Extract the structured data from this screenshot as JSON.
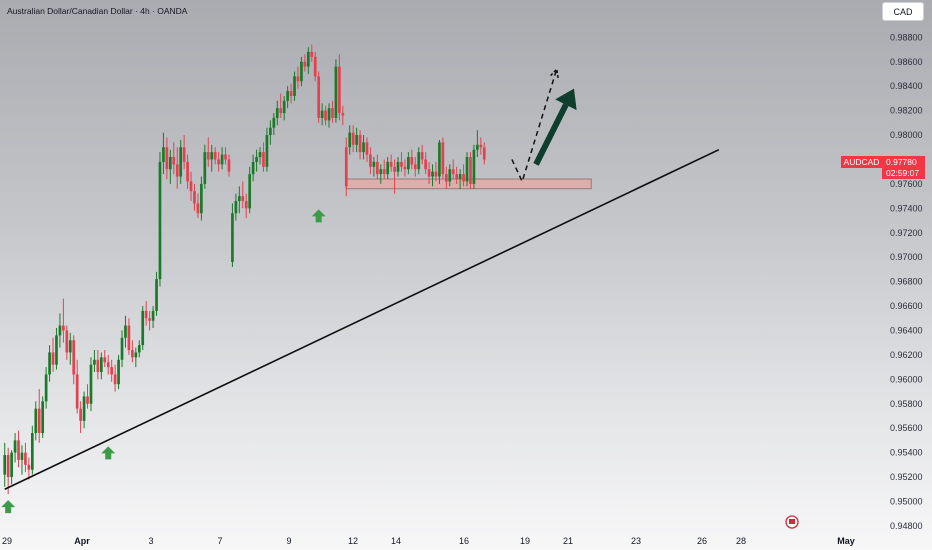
{
  "header": {
    "title": "Australian Dollar/Canadian Dollar · 4h · OANDA",
    "currency_button": "CAD"
  },
  "price_tag": {
    "symbol": "AUDCAD",
    "price": "0.97780",
    "countdown": "02:59:07",
    "color": "#f23645"
  },
  "colors": {
    "up": "#1b7a2a",
    "down": "#e2414f",
    "trendline": "#0d0d0d",
    "arrow": "#0f3d2e",
    "support_fill": "#e8a7a4",
    "signal_arrow": "#3d9a48"
  },
  "icons": [
    "flag-icon",
    "up-arrow-icon"
  ],
  "chart_data": {
    "type": "candlestick",
    "title": "Australian Dollar/Canadian Dollar · 4h · OANDA",
    "symbol": "AUDCAD",
    "ylim": [
      0.9475,
      0.9895
    ],
    "y_ticks": [
      "0.98800",
      "0.98600",
      "0.98400",
      "0.98200",
      "0.98000",
      "0.97800",
      "0.97600",
      "0.97400",
      "0.97200",
      "0.97000",
      "0.96800",
      "0.96600",
      "0.96400",
      "0.96200",
      "0.96000",
      "0.95800",
      "0.95600",
      "0.95400",
      "0.95200",
      "0.95000",
      "0.94800"
    ],
    "x_ticks": [
      {
        "label": "29",
        "bold": false
      },
      {
        "label": "Apr",
        "bold": true
      },
      {
        "label": "3",
        "bold": false
      },
      {
        "label": "7",
        "bold": false
      },
      {
        "label": "9",
        "bold": false
      },
      {
        "label": "12",
        "bold": false
      },
      {
        "label": "14",
        "bold": false
      },
      {
        "label": "16",
        "bold": false
      },
      {
        "label": "19",
        "bold": false
      },
      {
        "label": "21",
        "bold": false
      },
      {
        "label": "23",
        "bold": false
      },
      {
        "label": "26",
        "bold": false
      },
      {
        "label": "28",
        "bold": false
      },
      {
        "label": "May",
        "bold": true
      }
    ],
    "candles": [
      [
        0.9522,
        0.9548,
        0.9512,
        0.9538
      ],
      [
        0.9538,
        0.9544,
        0.9506,
        0.952
      ],
      [
        0.952,
        0.9542,
        0.9514,
        0.954
      ],
      [
        0.954,
        0.9556,
        0.9532,
        0.955
      ],
      [
        0.955,
        0.9558,
        0.9528,
        0.9534
      ],
      [
        0.9534,
        0.9546,
        0.9522,
        0.954
      ],
      [
        0.954,
        0.9548,
        0.9524,
        0.953
      ],
      [
        0.953,
        0.9536,
        0.9518,
        0.9526
      ],
      [
        0.9526,
        0.9562,
        0.9522,
        0.9556
      ],
      [
        0.9556,
        0.9582,
        0.955,
        0.9576
      ],
      [
        0.9576,
        0.9592,
        0.9548,
        0.9556
      ],
      [
        0.9556,
        0.9586,
        0.9552,
        0.9582
      ],
      [
        0.9582,
        0.961,
        0.9576,
        0.9604
      ],
      [
        0.9604,
        0.9628,
        0.9598,
        0.9622
      ],
      [
        0.9622,
        0.9634,
        0.9606,
        0.9612
      ],
      [
        0.9612,
        0.9642,
        0.9608,
        0.9636
      ],
      [
        0.9636,
        0.9654,
        0.9626,
        0.9644
      ],
      [
        0.9644,
        0.9666,
        0.963,
        0.964
      ],
      [
        0.964,
        0.9644,
        0.9616,
        0.9622
      ],
      [
        0.9622,
        0.9638,
        0.9612,
        0.9632
      ],
      [
        0.9632,
        0.9636,
        0.9596,
        0.9604
      ],
      [
        0.9604,
        0.9616,
        0.9572,
        0.9576
      ],
      [
        0.9576,
        0.9582,
        0.9556,
        0.9566
      ],
      [
        0.9566,
        0.959,
        0.956,
        0.9586
      ],
      [
        0.9586,
        0.9596,
        0.9576,
        0.958
      ],
      [
        0.958,
        0.9618,
        0.9574,
        0.9612
      ],
      [
        0.9612,
        0.9624,
        0.9606,
        0.9616
      ],
      [
        0.9616,
        0.9624,
        0.96,
        0.9606
      ],
      [
        0.9606,
        0.9622,
        0.96,
        0.9618
      ],
      [
        0.9618,
        0.9624,
        0.961,
        0.9614
      ],
      [
        0.9614,
        0.962,
        0.9604,
        0.961
      ],
      [
        0.961,
        0.9616,
        0.9598,
        0.9604
      ],
      [
        0.9604,
        0.9612,
        0.959,
        0.9596
      ],
      [
        0.9596,
        0.962,
        0.9592,
        0.9616
      ],
      [
        0.9616,
        0.964,
        0.961,
        0.9634
      ],
      [
        0.9634,
        0.9652,
        0.9626,
        0.9644
      ],
      [
        0.9644,
        0.965,
        0.962,
        0.9624
      ],
      [
        0.9624,
        0.9632,
        0.9614,
        0.9618
      ],
      [
        0.9618,
        0.9626,
        0.961,
        0.9622
      ],
      [
        0.9622,
        0.9632,
        0.9618,
        0.9628
      ],
      [
        0.9628,
        0.966,
        0.9624,
        0.9656
      ],
      [
        0.9656,
        0.9664,
        0.9644,
        0.965
      ],
      [
        0.965,
        0.9656,
        0.964,
        0.9648
      ],
      [
        0.9648,
        0.966,
        0.9642,
        0.9656
      ],
      [
        0.9656,
        0.9688,
        0.9652,
        0.9682
      ],
      [
        0.9682,
        0.9786,
        0.9676,
        0.9778
      ],
      [
        0.9778,
        0.9802,
        0.9768,
        0.979
      ],
      [
        0.979,
        0.9798,
        0.9764,
        0.9772
      ],
      [
        0.9772,
        0.9788,
        0.976,
        0.9782
      ],
      [
        0.9782,
        0.9794,
        0.9768,
        0.9776
      ],
      [
        0.9776,
        0.979,
        0.9756,
        0.9766
      ],
      [
        0.9766,
        0.9796,
        0.976,
        0.979
      ],
      [
        0.979,
        0.98,
        0.9772,
        0.9778
      ],
      [
        0.9778,
        0.9784,
        0.9756,
        0.9762
      ],
      [
        0.9762,
        0.977,
        0.9746,
        0.9754
      ],
      [
        0.9754,
        0.976,
        0.9738,
        0.9744
      ],
      [
        0.9744,
        0.9752,
        0.9732,
        0.9736
      ],
      [
        0.9736,
        0.9766,
        0.973,
        0.976
      ],
      [
        0.976,
        0.9792,
        0.9756,
        0.9786
      ],
      [
        0.9786,
        0.9798,
        0.9774,
        0.978
      ],
      [
        0.978,
        0.9792,
        0.977,
        0.9786
      ],
      [
        0.9786,
        0.979,
        0.9776,
        0.978
      ],
      [
        0.978,
        0.9786,
        0.977,
        0.9776
      ],
      [
        0.9776,
        0.979,
        0.9772,
        0.9784
      ],
      [
        0.9784,
        0.979,
        0.9776,
        0.978
      ],
      [
        0.978,
        0.9784,
        0.9766,
        0.977
      ],
      [
        0.9696,
        0.9744,
        0.9692,
        0.9736
      ],
      [
        0.9736,
        0.9752,
        0.973,
        0.9746
      ],
      [
        0.9746,
        0.9758,
        0.9736,
        0.975
      ],
      [
        0.975,
        0.9762,
        0.974,
        0.9746
      ],
      [
        0.9746,
        0.9752,
        0.9732,
        0.974
      ],
      [
        0.974,
        0.9774,
        0.9736,
        0.9768
      ],
      [
        0.9768,
        0.9784,
        0.9762,
        0.9778
      ],
      [
        0.9778,
        0.9788,
        0.977,
        0.9782
      ],
      [
        0.9782,
        0.979,
        0.9776,
        0.9786
      ],
      [
        0.9786,
        0.9794,
        0.977,
        0.9774
      ],
      [
        0.9774,
        0.9806,
        0.977,
        0.98
      ],
      [
        0.98,
        0.9812,
        0.9792,
        0.9806
      ],
      [
        0.9806,
        0.9818,
        0.98,
        0.9814
      ],
      [
        0.9814,
        0.9828,
        0.9808,
        0.9822
      ],
      [
        0.9822,
        0.9834,
        0.9814,
        0.9818
      ],
      [
        0.9818,
        0.9832,
        0.9812,
        0.9828
      ],
      [
        0.9828,
        0.984,
        0.9822,
        0.9836
      ],
      [
        0.9836,
        0.9842,
        0.9826,
        0.9832
      ],
      [
        0.9832,
        0.9852,
        0.9828,
        0.9848
      ],
      [
        0.9848,
        0.9856,
        0.9838,
        0.9844
      ],
      [
        0.9844,
        0.9864,
        0.984,
        0.986
      ],
      [
        0.986,
        0.9866,
        0.9852,
        0.9856
      ],
      [
        0.9856,
        0.9872,
        0.985,
        0.9868
      ],
      [
        0.9868,
        0.9874,
        0.986,
        0.9864
      ],
      [
        0.9864,
        0.9868,
        0.9844,
        0.9848
      ],
      [
        0.9848,
        0.9852,
        0.981,
        0.9814
      ],
      [
        0.9814,
        0.9826,
        0.9808,
        0.982
      ],
      [
        0.982,
        0.9824,
        0.9808,
        0.9812
      ],
      [
        0.9812,
        0.9826,
        0.9806,
        0.9822
      ],
      [
        0.9822,
        0.9828,
        0.981,
        0.9814
      ],
      [
        0.9814,
        0.9862,
        0.981,
        0.9856
      ],
      [
        0.9856,
        0.9866,
        0.9812,
        0.9818
      ],
      [
        0.9818,
        0.9824,
        0.9808,
        0.9816
      ],
      [
        0.979,
        0.9798,
        0.975,
        0.9758
      ],
      [
        0.979,
        0.9808,
        0.9784,
        0.9802
      ],
      [
        0.9802,
        0.9808,
        0.9786,
        0.9792
      ],
      [
        0.9792,
        0.9806,
        0.9786,
        0.98
      ],
      [
        0.98,
        0.9804,
        0.978,
        0.9786
      ],
      [
        0.9786,
        0.98,
        0.978,
        0.9794
      ],
      [
        0.9794,
        0.9798,
        0.9778,
        0.9784
      ],
      [
        0.9784,
        0.979,
        0.9768,
        0.9774
      ],
      [
        0.9774,
        0.9782,
        0.9766,
        0.9778
      ],
      [
        0.9778,
        0.9784,
        0.9764,
        0.9768
      ],
      [
        0.9768,
        0.9776,
        0.976,
        0.9772
      ],
      [
        0.9772,
        0.978,
        0.9764,
        0.9768
      ],
      [
        0.9768,
        0.9782,
        0.9764,
        0.9778
      ],
      [
        0.9778,
        0.9784,
        0.977,
        0.9774
      ],
      [
        0.9774,
        0.978,
        0.9752,
        0.977
      ],
      [
        0.977,
        0.9782,
        0.9766,
        0.9778
      ],
      [
        0.9778,
        0.9786,
        0.977,
        0.9774
      ],
      [
        0.9774,
        0.978,
        0.9766,
        0.9772
      ],
      [
        0.9772,
        0.9786,
        0.9768,
        0.9782
      ],
      [
        0.9782,
        0.9788,
        0.9772,
        0.9776
      ],
      [
        0.9776,
        0.9782,
        0.9766,
        0.9772
      ],
      [
        0.9772,
        0.979,
        0.9768,
        0.9786
      ],
      [
        0.9786,
        0.9792,
        0.9776,
        0.978
      ],
      [
        0.978,
        0.9786,
        0.9768,
        0.9772
      ],
      [
        0.9772,
        0.9778,
        0.976,
        0.9766
      ],
      [
        0.9766,
        0.9776,
        0.9758,
        0.977
      ],
      [
        0.977,
        0.9778,
        0.9762,
        0.9766
      ],
      [
        0.9766,
        0.9796,
        0.976,
        0.9794
      ],
      [
        0.9794,
        0.9798,
        0.9764,
        0.9768
      ],
      [
        0.9768,
        0.9774,
        0.9756,
        0.9762
      ],
      [
        0.9762,
        0.9776,
        0.9758,
        0.9772
      ],
      [
        0.9772,
        0.978,
        0.9764,
        0.9768
      ],
      [
        0.9768,
        0.9774,
        0.976,
        0.9764
      ],
      [
        0.9764,
        0.9772,
        0.9756,
        0.9768
      ],
      [
        0.9768,
        0.9776,
        0.9758,
        0.9762
      ],
      [
        0.9762,
        0.9786,
        0.9758,
        0.9782
      ],
      [
        0.9782,
        0.9786,
        0.9756,
        0.976
      ],
      [
        0.976,
        0.9792,
        0.9756,
        0.9788
      ],
      [
        0.9788,
        0.9804,
        0.9782,
        0.9792
      ],
      [
        0.9792,
        0.9798,
        0.9784,
        0.979
      ],
      [
        0.979,
        0.9794,
        0.9776,
        0.978
      ]
    ],
    "support_zone": {
      "from_bar": 99,
      "to_bar": 170,
      "low": 0.9756,
      "high": 0.9764
    },
    "trendline": {
      "from": {
        "bar": 0,
        "price": 0.951
      },
      "to": {
        "bar": 207,
        "price": 0.9788
      }
    },
    "projection": {
      "points": [
        {
          "bar": 147,
          "price": 0.978
        },
        {
          "bar": 150,
          "price": 0.9762
        },
        {
          "bar": 160,
          "price": 0.9854
        }
      ]
    },
    "big_arrow": {
      "from": {
        "bar": 154,
        "price": 0.9776
      },
      "to": {
        "bar": 165,
        "price": 0.9838
      }
    },
    "signal_arrows": [
      {
        "bar": 1,
        "price": 0.9506
      },
      {
        "bar": 30,
        "price": 0.955
      },
      {
        "bar": 91,
        "price": 0.9744
      }
    ]
  }
}
